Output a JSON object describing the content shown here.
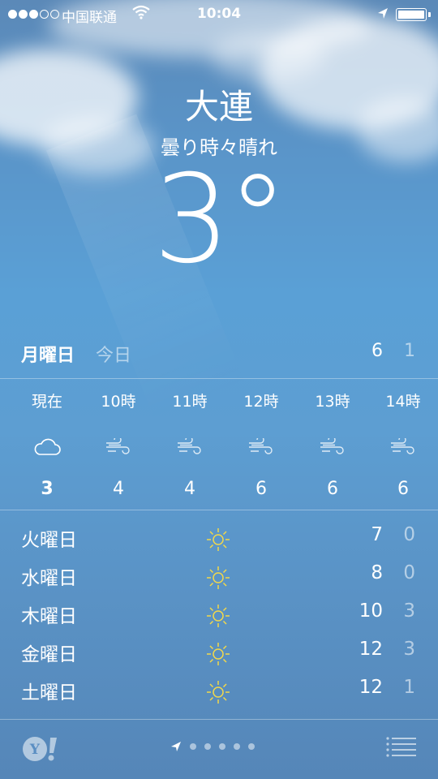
{
  "status_bar": {
    "carrier": "中国联通",
    "time": "10:04",
    "signal_bars": 3,
    "signal_total": 5
  },
  "header": {
    "city": "大連",
    "condition": "曇り時々晴れ",
    "temperature": "3°"
  },
  "today": {
    "day": "月曜日",
    "label": "今日",
    "high": "6",
    "low": "1"
  },
  "hourly": [
    {
      "time": "現在",
      "icon": "cloud-icon",
      "temp": "3"
    },
    {
      "time": "10時",
      "icon": "wind-icon",
      "temp": "4"
    },
    {
      "time": "11時",
      "icon": "wind-icon",
      "temp": "4"
    },
    {
      "time": "12時",
      "icon": "wind-icon",
      "temp": "6"
    },
    {
      "time": "13時",
      "icon": "wind-icon",
      "temp": "6"
    },
    {
      "time": "14時",
      "icon": "wind-icon",
      "temp": "6"
    }
  ],
  "daily": [
    {
      "day": "火曜日",
      "icon": "sun-icon",
      "high": "7",
      "low": "0"
    },
    {
      "day": "水曜日",
      "icon": "sun-icon",
      "high": "8",
      "low": "0"
    },
    {
      "day": "木曜日",
      "icon": "sun-icon",
      "high": "10",
      "low": "3"
    },
    {
      "day": "金曜日",
      "icon": "sun-icon",
      "high": "12",
      "low": "3"
    },
    {
      "day": "土曜日",
      "icon": "sun-icon",
      "high": "12",
      "low": "1"
    }
  ],
  "pager": {
    "pages": 5,
    "current_is_location": true
  },
  "colors": {
    "sun": "#f2d84a",
    "background_top": "#5b89b8",
    "background_bottom": "#5586b8"
  }
}
